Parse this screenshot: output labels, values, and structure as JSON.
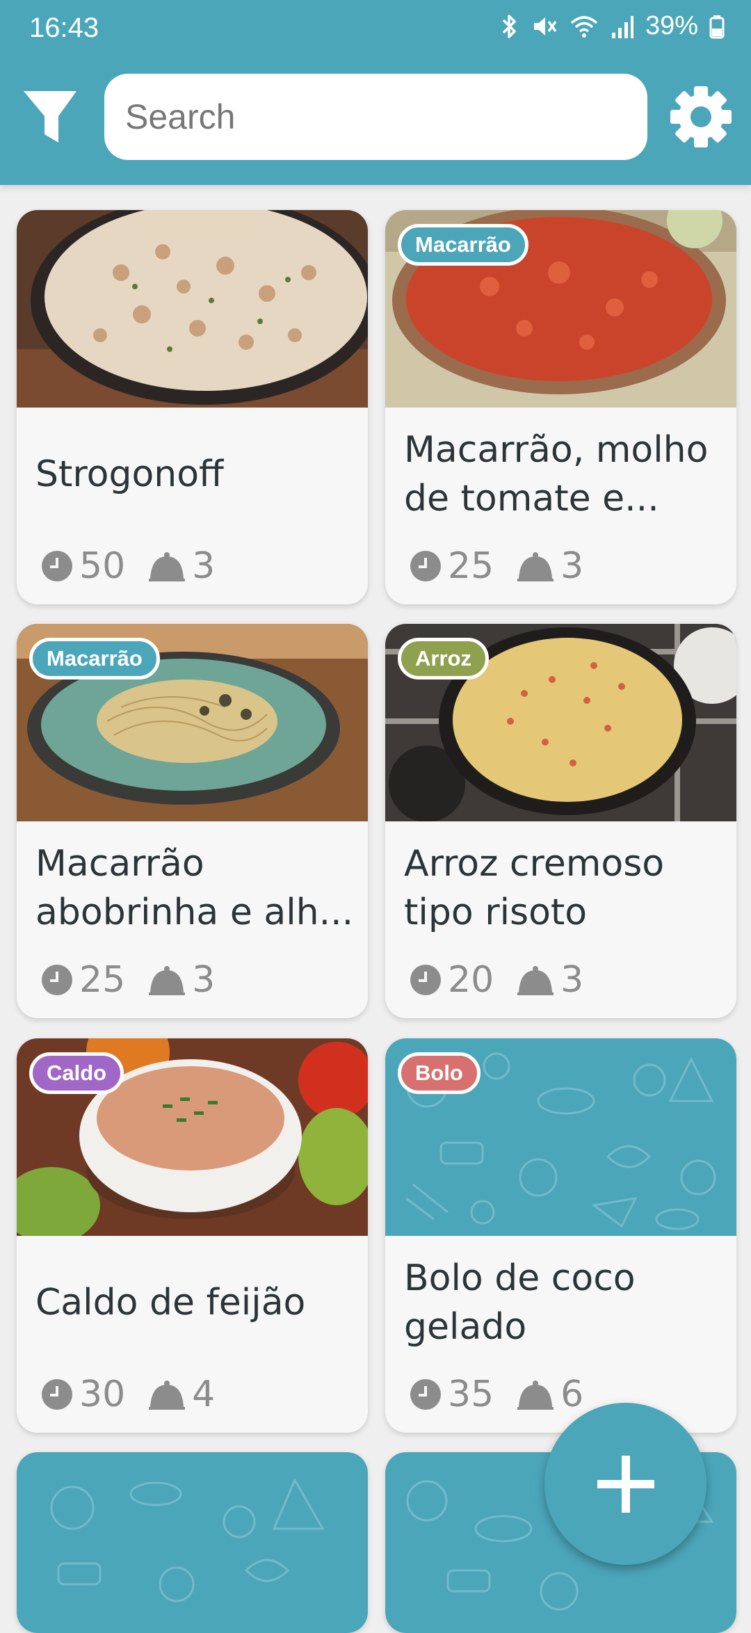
{
  "status_bar": {
    "time": "16:43",
    "battery": "39%"
  },
  "search": {
    "placeholder": "Search"
  },
  "recipes": [
    {
      "title": "Strogonoff",
      "time": "50",
      "servings": "3",
      "tag": ""
    },
    {
      "title": "Macarrão, molho de tomate e...",
      "time": "25",
      "servings": "3",
      "tag": "Macarrão",
      "tag_color": "#4ba6ba"
    },
    {
      "title": "Macarrão abobrinha e alh...",
      "time": "25",
      "servings": "3",
      "tag": "Macarrão",
      "tag_color": "#4ba6ba"
    },
    {
      "title": "Arroz cremoso tipo risoto",
      "time": "20",
      "servings": "3",
      "tag": "Arroz",
      "tag_color": "#8fa04f"
    },
    {
      "title": "Caldo de feijão",
      "time": "30",
      "servings": "4",
      "tag": "Caldo",
      "tag_color": "#a067c6"
    },
    {
      "title": "Bolo de coco gelado",
      "time": "35",
      "servings": "6",
      "tag": "Bolo",
      "tag_color": "#d6716f"
    }
  ],
  "colors": {
    "primary": "#4ba6ba",
    "card_bg": "#f7f7f7",
    "text": "#2c3437",
    "meta": "#8c8c8c"
  },
  "icons": [
    "filter-icon",
    "gear-icon",
    "clock-icon",
    "cloche-icon",
    "plus-icon"
  ]
}
